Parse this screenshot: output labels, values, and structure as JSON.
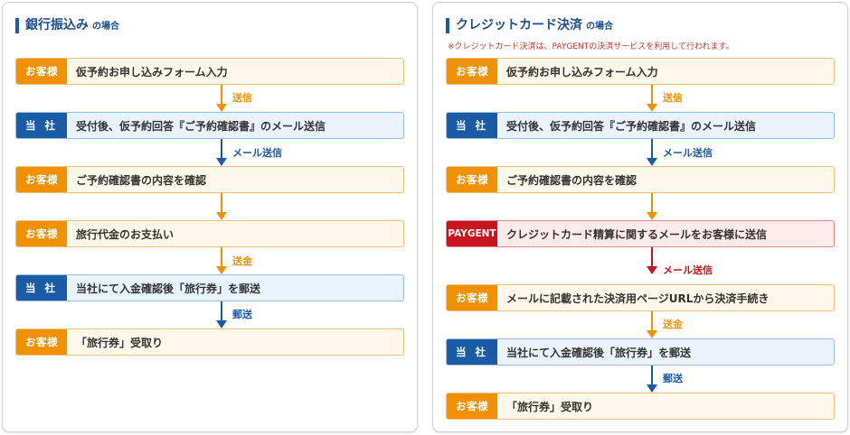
{
  "left": {
    "title": "銀行振込み",
    "title_suffix": "の場合",
    "steps": [
      {
        "tag": "お客様",
        "text": "仮予約お申し込みフォーム入力"
      },
      {
        "tag": "当 社",
        "text": "受付後、仮予約回答『ご予約確認書』のメール送信"
      },
      {
        "tag": "お客様",
        "text": "ご予約確認書の内容を確認"
      },
      {
        "tag": "お客様",
        "text": "旅行代金のお支払い"
      },
      {
        "tag": "当 社",
        "text": "当社にて入金確認後「旅行券」を郵送"
      },
      {
        "tag": "お客様",
        "text": "「旅行券」受取り"
      }
    ],
    "arrows": [
      "送信",
      "メール送信",
      "",
      "送金",
      "郵送"
    ]
  },
  "right": {
    "title": "クレジットカード決済",
    "title_suffix": "の場合",
    "note": "※クレジットカード決済は、PAYGENTの決済サービスを利用して行われます。",
    "steps": [
      {
        "tag": "お客様",
        "text": "仮予約お申し込みフォーム入力"
      },
      {
        "tag": "当 社",
        "text": "受付後、仮予約回答『ご予約確認書』のメール送信"
      },
      {
        "tag": "お客様",
        "text": "ご予約確認書の内容を確認"
      },
      {
        "tag": "PAYGENT",
        "text": "クレジットカード精算に関するメールをお客様に送信"
      },
      {
        "tag": "お客様",
        "text": "メールに記載された決済用ページURLから決済手続き"
      },
      {
        "tag": "当 社",
        "text": "当社にて入金確認後「旅行券」を郵送"
      },
      {
        "tag": "お客様",
        "text": "「旅行券」受取り"
      }
    ],
    "arrows": [
      "送信",
      "メール送信",
      "",
      "メール送信",
      "送金",
      "郵送"
    ]
  },
  "colors": {
    "customer": "#f29100",
    "company": "#1a5ba6",
    "paygent": "#c8141e"
  }
}
